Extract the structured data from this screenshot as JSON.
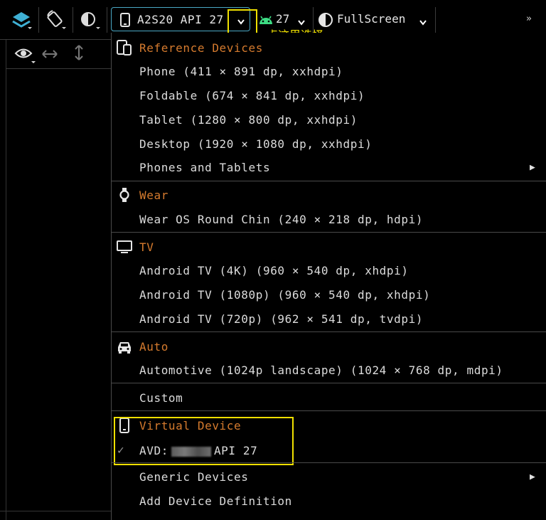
{
  "toolbar": {
    "device_label": "A2S20 API 27",
    "api_level": "27",
    "display_mode": "FullScreen",
    "annotation": "点这里选择",
    "more": "»",
    "highlight_color": "#f0e000",
    "accent_color": "#d67b2e"
  },
  "menu": {
    "sections": [
      {
        "header": "Reference Devices",
        "icon": "phone-tablet-icon",
        "items": [
          "Phone (411 × 891 dp, xxhdpi)",
          "Foldable (674 × 841 dp, xxhdpi)",
          "Tablet (1280 × 800 dp, xxhdpi)",
          "Desktop (1920 × 1080 dp, xxhdpi)",
          "Phones and Tablets"
        ]
      },
      {
        "header": "Wear",
        "icon": "watch-icon",
        "items": [
          "Wear OS Round Chin (240 × 218 dp, hdpi)"
        ]
      },
      {
        "header": "TV",
        "icon": "tv-icon",
        "items": [
          "Android TV (4K) (960 × 540 dp, xhdpi)",
          "Android TV (1080p) (960 × 540 dp, xhdpi)",
          "Android TV (720p) (962 × 541 dp, tvdpi)"
        ]
      },
      {
        "header": "Auto",
        "icon": "car-icon",
        "items": [
          "Automotive (1024p landscape) (1024 × 768 dp, mdpi)"
        ]
      },
      {
        "items": [
          "Custom"
        ]
      },
      {
        "header": "Virtual Device",
        "icon": "phone-icon",
        "items": [
          "AVD:",
          "API 27"
        ]
      },
      {
        "items": [
          "Generic Devices",
          "Add Device Definition"
        ]
      }
    ]
  }
}
